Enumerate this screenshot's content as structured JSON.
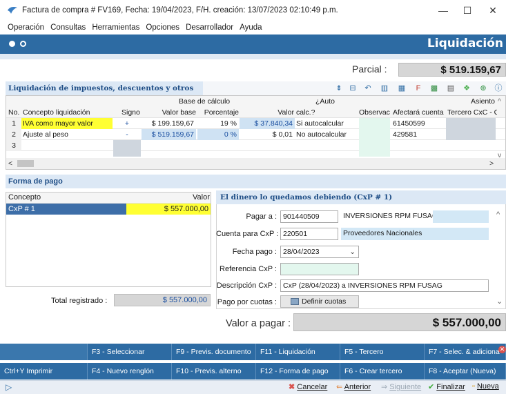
{
  "window": {
    "title": "Factura de compra # FV169, Fecha: 19/04/2023, F/H. creación: 13/07/2023 02:10:49 p.m.",
    "controls": [
      "—",
      "☐",
      "✕"
    ]
  },
  "menu": [
    "Operación",
    "Consultas",
    "Herramientas",
    "Opciones",
    "Desarrollador",
    "Ayuda"
  ],
  "header": {
    "title": "Liquidación"
  },
  "parcial": {
    "label": "Parcial :",
    "value": "$ 519.159,67"
  },
  "liquidacion": {
    "section_title": "Liquidación de impuestos, descuentos y otros cargos",
    "group_headers": {
      "base": "Base de cálculo",
      "auto": "¿Auto",
      "asiento": "Asiento"
    },
    "columns": [
      "No.",
      "Concepto liquidación",
      "Signo",
      "Valor base",
      "Porcentaje",
      "Valor",
      "calc.?",
      "Observac",
      "Afectará cuenta",
      "Tercero CxC - C"
    ],
    "rows": [
      {
        "no": "1",
        "concepto": "IVA como mayor valor",
        "signo": "+",
        "valor_base": "$ 199.159,67",
        "porcentaje": "19 %",
        "valor": "$ 37.840,34",
        "auto": "Si autocalcular",
        "cuenta": "61450599"
      },
      {
        "no": "2",
        "concepto": "Ajuste al peso",
        "signo": "-",
        "valor_base": "$ 519.159,67",
        "porcentaje": "0 %",
        "valor": "$ 0,01",
        "auto": "No autocalcular",
        "cuenta": "429581"
      },
      {
        "no": "3",
        "concepto": "",
        "signo": "",
        "valor_base": "",
        "porcentaje": "",
        "valor": "",
        "auto": "",
        "cuenta": ""
      }
    ]
  },
  "forma_pago": {
    "section_title": "Forma de pago",
    "columns": [
      "Concepto",
      "Valor"
    ],
    "rows": [
      {
        "concepto": "CxP # 1",
        "valor": "$ 557.000,00"
      }
    ],
    "total_label": "Total registrado :",
    "total_value": "$ 557.000,00"
  },
  "cxp": {
    "title": "El dinero lo quedamos debiendo (CxP # 1)",
    "pagar_a_label": "Pagar a :",
    "pagar_a_id": "901440509",
    "pagar_a_name": "INVERSIONES RPM FUSAGASUGA S",
    "cuenta_label": "Cuenta para CxP :",
    "cuenta_code": "220501",
    "cuenta_name": "Proveedores Nacionales",
    "fecha_label": "Fecha pago :",
    "fecha_value": "28/04/2023",
    "referencia_label": "Referencia CxP :",
    "referencia_value": "",
    "descripcion_label": "Descripción CxP :",
    "descripcion_value": "CxP (28/04/2023) a INVERSIONES RPM FUSAG",
    "cuotas_label": "Pago por cuotas :",
    "cuotas_button": "Definir cuotas"
  },
  "valor_pagar": {
    "label": "Valor a pagar :",
    "value": "$ 557.000,00"
  },
  "fkeys_row1": [
    "F3 - Seleccionar",
    "F9 - Previs. documento",
    "F11 - Liquidación",
    "F5 - Tercero",
    "F7 - Selec. & adiciona"
  ],
  "fkeys_row2": [
    "Ctrl+Y Imprimir",
    "F4 - Nuevo renglón",
    "F10 - Previs. alterno",
    "F12 - Forma de pago",
    "F6 - Crear tercero",
    "F8 - Aceptar (Nueva)"
  ],
  "bottom": {
    "cancelar": "Cancelar",
    "anterior": "Anterior",
    "siguiente": "Siguiente",
    "finalizar": "Finalizar",
    "nueva": "Nueva"
  }
}
